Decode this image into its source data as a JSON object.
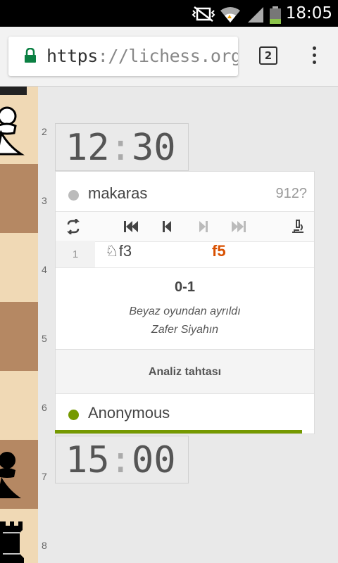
{
  "status_bar": {
    "time": "18:05",
    "battery_color": "#8bc34a"
  },
  "browser": {
    "url_scheme": "https",
    "url_rest": "://lichess.org/oXm",
    "tab_count": "2"
  },
  "board": {
    "ranks": [
      "2",
      "3",
      "4",
      "5",
      "6",
      "7",
      "8"
    ]
  },
  "clocks": {
    "top": {
      "minutes": "12",
      "seconds": "30"
    },
    "bottom": {
      "minutes": "15",
      "seconds": "00"
    }
  },
  "players": {
    "top": {
      "name": "makaras",
      "rating": "912?",
      "dot_color": "#bbbbbb"
    },
    "bottom": {
      "name": "Anonymous",
      "dot_color": "#759900"
    }
  },
  "moves": [
    {
      "number": "1",
      "white_piece": "knight-icon",
      "white": "f3",
      "black": "f5"
    }
  ],
  "result": {
    "score": "0-1",
    "line1": "Beyaz oyundan ayrıldı",
    "line2": "Zafer Siyahın"
  },
  "analysis_button": "Analiz tahtası",
  "colors": {
    "accent": "#759900",
    "last_move": "#d85000",
    "light_square": "#f0d9b5",
    "dark_square": "#b58863"
  }
}
